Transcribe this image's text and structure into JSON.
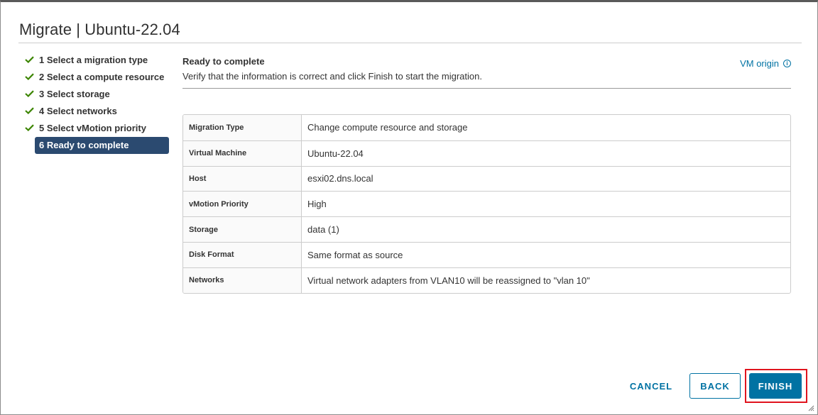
{
  "dialog": {
    "title": "Migrate | Ubuntu-22.04"
  },
  "steps": [
    {
      "label": "1 Select a migration type",
      "state": "done"
    },
    {
      "label": "2 Select a compute resource",
      "state": "done"
    },
    {
      "label": "3 Select storage",
      "state": "done"
    },
    {
      "label": "4 Select networks",
      "state": "done"
    },
    {
      "label": "5 Select vMotion priority",
      "state": "done"
    },
    {
      "label": "6 Ready to complete",
      "state": "active"
    }
  ],
  "main": {
    "title": "Ready to complete",
    "description": "Verify that the information is correct and click Finish to start the migration.",
    "vm_origin_link": "VM origin",
    "summary": [
      {
        "key": "Migration Type",
        "value": "Change compute resource and storage"
      },
      {
        "key": "Virtual Machine",
        "value": "Ubuntu-22.04"
      },
      {
        "key": "Host",
        "value": "esxi02.dns.local"
      },
      {
        "key": "vMotion Priority",
        "value": "High"
      },
      {
        "key": "Storage",
        "value": "data (1)"
      },
      {
        "key": "Disk Format",
        "value": "Same format as source"
      },
      {
        "key": "Networks",
        "value": "Virtual network adapters from VLAN10 will be reassigned to \"vlan 10\""
      }
    ]
  },
  "footer": {
    "cancel_label": "CANCEL",
    "back_label": "BACK",
    "finish_label": "FINISH"
  },
  "colors": {
    "accent": "#0072a3",
    "active_step": "#2b4a70",
    "check": "#3c8500",
    "highlight": "#e0141e"
  },
  "icons": {
    "step_done": "check-icon",
    "vm_origin": "info-icon",
    "resize": "resize-grip-icon"
  }
}
